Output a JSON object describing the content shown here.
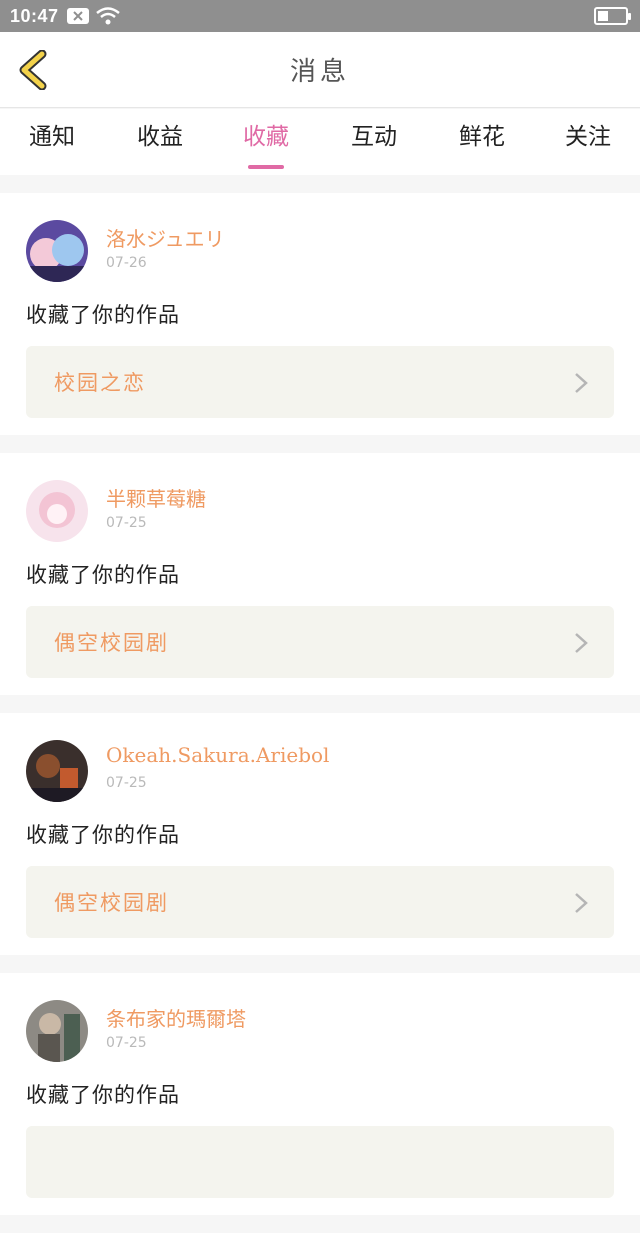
{
  "status_bar": {
    "time": "10:47",
    "icons": [
      "notification-x-icon",
      "wifi-icon",
      "battery-icon"
    ]
  },
  "header": {
    "title": "消息",
    "back_icon": "chevron-left-icon"
  },
  "tabs": [
    {
      "label": "通知",
      "active": false
    },
    {
      "label": "收益",
      "active": false
    },
    {
      "label": "收藏",
      "active": true
    },
    {
      "label": "互动",
      "active": false
    },
    {
      "label": "鲜花",
      "active": false
    },
    {
      "label": "关注",
      "active": false
    }
  ],
  "feed": [
    {
      "username": "洛水ジュエリ",
      "date": "07-26",
      "action": "收藏了你的作品",
      "work_title": "校园之恋"
    },
    {
      "username": "半颗草莓糖",
      "date": "07-25",
      "action": "收藏了你的作品",
      "work_title": "偶空校园剧"
    },
    {
      "username": "Okeah.Sakura.Ariebol",
      "date": "07-25",
      "action": "收藏了你的作品",
      "work_title": "偶空校园剧"
    },
    {
      "username": "条布家的瑪爾塔",
      "date": "07-25",
      "action": "收藏了你的作品",
      "work_title": ""
    }
  ],
  "colors": {
    "accent_pink": "#e06aa5",
    "username_orange": "#ef9a62",
    "back_yellow": "#f3d24a"
  }
}
